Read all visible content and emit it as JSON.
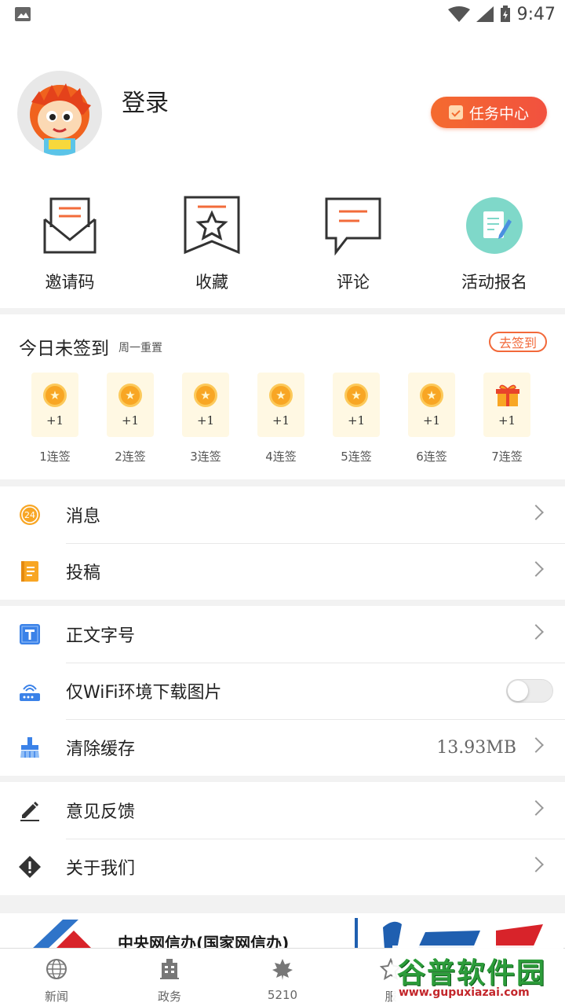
{
  "status_bar": {
    "time": "9:47"
  },
  "profile": {
    "login_label": "登录",
    "task_center_label": "任务中心"
  },
  "quick_actions": [
    {
      "label": "邀请码",
      "icon": "invite-envelope-icon"
    },
    {
      "label": "收藏",
      "icon": "bookmark-star-icon"
    },
    {
      "label": "评论",
      "icon": "comment-bubble-icon"
    },
    {
      "label": "活动报名",
      "icon": "signup-form-icon"
    }
  ],
  "checkin": {
    "title": "今日未签到",
    "subtitle": "周一重置",
    "button_label": "去签到",
    "days": [
      {
        "reward": "+1",
        "label": "1连签"
      },
      {
        "reward": "+1",
        "label": "2连签"
      },
      {
        "reward": "+1",
        "label": "3连签"
      },
      {
        "reward": "+1",
        "label": "4连签"
      },
      {
        "reward": "+1",
        "label": "5连签"
      },
      {
        "reward": "+1",
        "label": "6连签"
      },
      {
        "reward": "+1",
        "label": "7连签"
      }
    ]
  },
  "menu": {
    "messages": "消息",
    "message_badge": "24",
    "submit": "投稿",
    "font_size": "正文字号",
    "wifi_images": "仅WiFi环境下载图片",
    "clear_cache": "清除缓存",
    "cache_size": "13.93MB",
    "feedback": "意见反馈",
    "about": "关于我们"
  },
  "banner": {
    "text": "中央网信办(国家网信办)"
  },
  "tabs": [
    {
      "label": "新闻",
      "icon": "globe-icon"
    },
    {
      "label": "政务",
      "icon": "building-icon"
    },
    {
      "label": "5210",
      "icon": "maple-leaf-icon"
    },
    {
      "label": "服",
      "icon": "star-icon"
    }
  ],
  "watermark": {
    "title": "谷普软件园",
    "url": "www.gupuxiazai.com"
  },
  "colors": {
    "accent": "#f2693a",
    "teal": "#7fd8c9",
    "blue": "#3b82e8",
    "orange": "#f8a624"
  }
}
